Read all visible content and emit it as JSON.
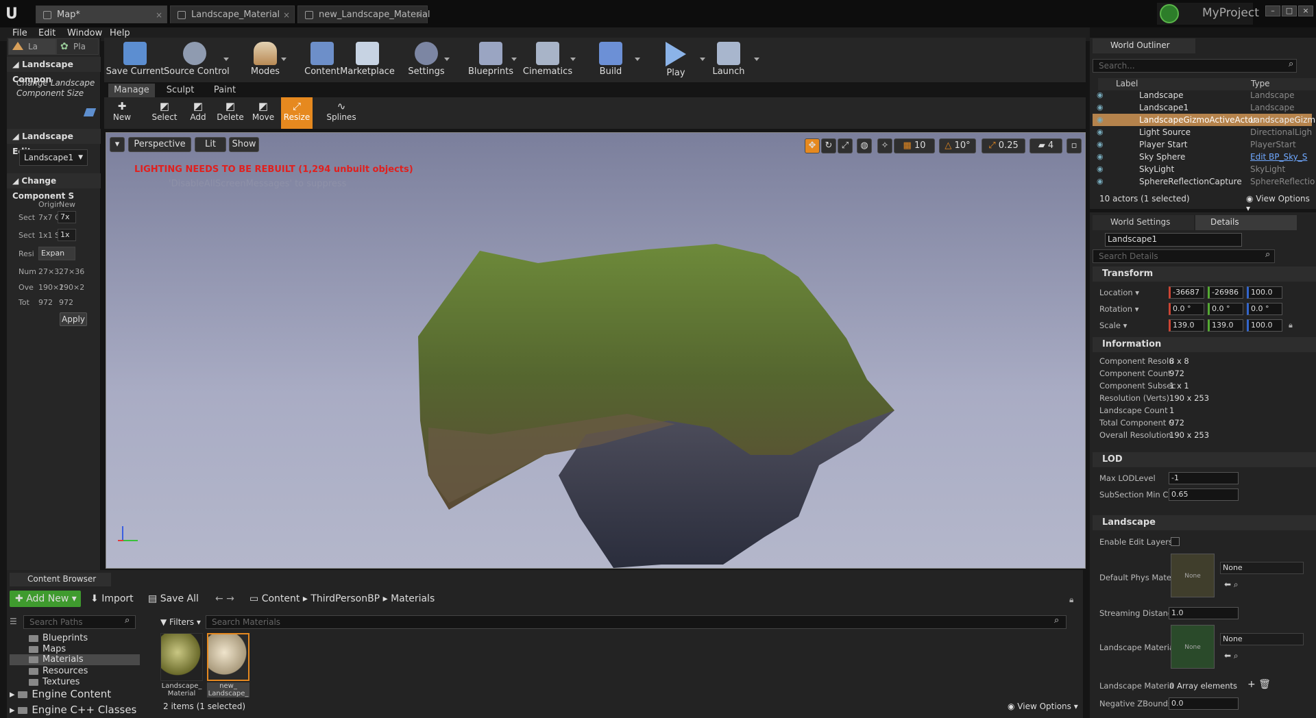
{
  "tabs": [
    "Map*",
    "Landscape_Material",
    "new_Landscape_Material"
  ],
  "project": "MyProject",
  "menu": [
    "File",
    "Edit",
    "Window",
    "Help"
  ],
  "left": {
    "tabs": [
      "La",
      "Pla"
    ],
    "sec1": "Landscape Compon",
    "desc": "Change Landscape Component Size",
    "sec2": "Landscape Editor",
    "landscape": "Landscape1",
    "sec3": "Change Component S",
    "hdr1": "Origir",
    "hdr2": "New",
    "rows": [
      {
        "l": "Sect",
        "a": "7x7 C",
        "b": "7x"
      },
      {
        "l": "Sect",
        "a": "1x1 S",
        "b": "1x"
      },
      {
        "l": "Resi",
        "a": "Expan",
        "b": ""
      },
      {
        "l": "Num",
        "a": "27×3",
        "b": "27×36"
      },
      {
        "l": "Ove",
        "a": "190×2",
        "b": "190×2"
      },
      {
        "l": "Tot",
        "a": "972",
        "b": "972"
      }
    ],
    "apply": "Apply"
  },
  "toolbar": [
    "Save Current",
    "Source Control",
    "Modes",
    "Content",
    "Marketplace",
    "Settings",
    "Blueprints",
    "Cinematics",
    "Build",
    "Play",
    "Launch"
  ],
  "modes": [
    "Manage",
    "Sculpt",
    "Paint"
  ],
  "subtools": [
    "New",
    "Select",
    "Add",
    "Delete",
    "Move",
    "Resize",
    "Splines"
  ],
  "viewport": {
    "perspective": "Perspective",
    "lit": "Lit",
    "show": "Show",
    "grid": "10",
    "angle": "10°",
    "scale": "0.25",
    "cam": "4",
    "warning": "LIGHTING NEEDS TO BE REBUILT (1,294 unbuilt objects)",
    "suppress": "'DisableAllScreenMessages' to suppress"
  },
  "outliner": {
    "title": "World Outliner",
    "search": "Search...",
    "col_label": "Label",
    "col_type": "Type",
    "rows": [
      {
        "label": "Landscape",
        "type": "Landscape"
      },
      {
        "label": "Landscape1",
        "type": "Landscape"
      },
      {
        "label": "LandscapeGizmoActiveActor",
        "type": "LandscapeGizm"
      },
      {
        "label": "Light Source",
        "type": "DirectionalLigh"
      },
      {
        "label": "Player Start",
        "type": "PlayerStart"
      },
      {
        "label": "Sky Sphere",
        "type": "Edit BP_Sky_S"
      },
      {
        "label": "SkyLight",
        "type": "SkyLight"
      },
      {
        "label": "SphereReflectionCapture",
        "type": "SphereReflectio"
      }
    ],
    "count": "10 actors (1 selected)",
    "view": "View Options"
  },
  "details": {
    "tab1": "World Settings",
    "tab2": "Details",
    "name": "Landscape1",
    "search": "Search Details",
    "transform": "Transform",
    "loc": {
      "l": "Location",
      "v": [
        "-36687",
        "-26986",
        "100.0"
      ]
    },
    "rot": {
      "l": "Rotation",
      "v": [
        "0.0 °",
        "0.0 °",
        "0.0 °"
      ]
    },
    "scl": {
      "l": "Scale",
      "v": [
        "139.0",
        "139.0",
        "100.0"
      ]
    },
    "info": "Information",
    "inforows": [
      {
        "l": "Component Resolu",
        "v": "8 x 8"
      },
      {
        "l": "Component Count",
        "v": "972"
      },
      {
        "l": "Component Subsec",
        "v": "1 x 1"
      },
      {
        "l": "Resolution (Verts)",
        "v": "190 x 253"
      },
      {
        "l": "Landscape Count",
        "v": "1"
      },
      {
        "l": "Total Component C",
        "v": "972"
      },
      {
        "l": "Overall Resolution",
        "v": "190 x 253"
      }
    ],
    "lod": "LOD",
    "maxlod": {
      "l": "Max LODLevel",
      "v": "-1"
    },
    "submin": {
      "l": "SubSection Min Co",
      "v": "0.65"
    },
    "landscape": "Landscape",
    "edit_layers": "Enable Edit Layers",
    "phys": "Default Phys Mater",
    "none": "None",
    "stream": {
      "l": "Streaming Distanc",
      "v": "1.0"
    },
    "lmat": "Landscape Materia",
    "lmat2": "Landscape Materia",
    "arr": "0 Array elements",
    "negz": {
      "l": "Negative ZBounds",
      "v": "0.0"
    }
  },
  "cb": {
    "title": "Content Browser",
    "addnew": "Add New",
    "import": "Import",
    "saveall": "Save All",
    "path": [
      "Content",
      "ThirdPersonBP",
      "Materials"
    ],
    "searchpaths": "Search Paths",
    "filters": "Filters",
    "searchmat": "Search Materials",
    "tree": [
      "Blueprints",
      "Maps",
      "Materials",
      "Resources",
      "Textures"
    ],
    "engine": "Engine Content",
    "cpp": "Engine C++ Classes",
    "assets": [
      {
        "n1": "Landscape_",
        "n2": "Material"
      },
      {
        "n1": "new_",
        "n2": "Landscape_"
      }
    ],
    "count": "2 items (1 selected)",
    "view": "View Options"
  },
  "colors": {
    "accent": "#e6891f",
    "warning": "#e0201e",
    "green": "#3f9b2e"
  }
}
